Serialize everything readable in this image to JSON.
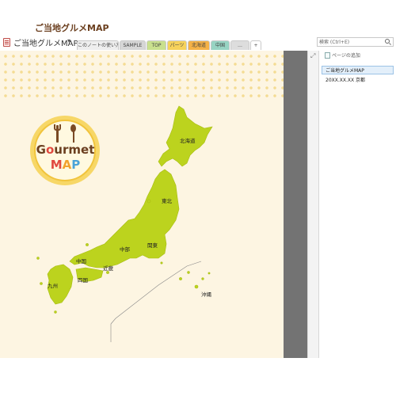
{
  "notebook": {
    "title": "ご当地グルメMAP",
    "caret": "▾"
  },
  "tabs": [
    {
      "label": "このノートの使い方",
      "color": "#eeeeee"
    },
    {
      "label": "SAMPLE",
      "color": "#d6d6d6"
    },
    {
      "label": "TOP",
      "color": "#c9e08e"
    },
    {
      "label": "パーツ",
      "color": "#f6d25b"
    },
    {
      "label": "北海道",
      "color": "#f5b247"
    },
    {
      "label": "中国",
      "color": "#97d4c3"
    },
    {
      "label": "…",
      "color": "#dddddd"
    },
    {
      "label": "+",
      "color": "#ffffff"
    }
  ],
  "search": {
    "placeholder": "検索 (Ctrl+E)"
  },
  "page": {
    "title": "ご当地グルメMAP",
    "badge_line1": "Gourmet",
    "badge_line2": "MAP"
  },
  "map_labels": {
    "hokkaido": "北海道",
    "tohoku": "東北",
    "kanto": "関東",
    "chubu": "中部",
    "kinki": "近畿",
    "chugoku": "中国",
    "shikoku": "四国",
    "kyushu": "九州",
    "okinawa": "沖縄"
  },
  "right_pane": {
    "add_page": "ページの追加",
    "pages": [
      "ご当地グルメMAP",
      "20XX.XX.XX 京都"
    ]
  },
  "colors": {
    "land": "#bcd31e",
    "land_edge": "#a7bd12",
    "page_bg": "#fdf5e2",
    "title_brown": "#6b3f1f"
  }
}
